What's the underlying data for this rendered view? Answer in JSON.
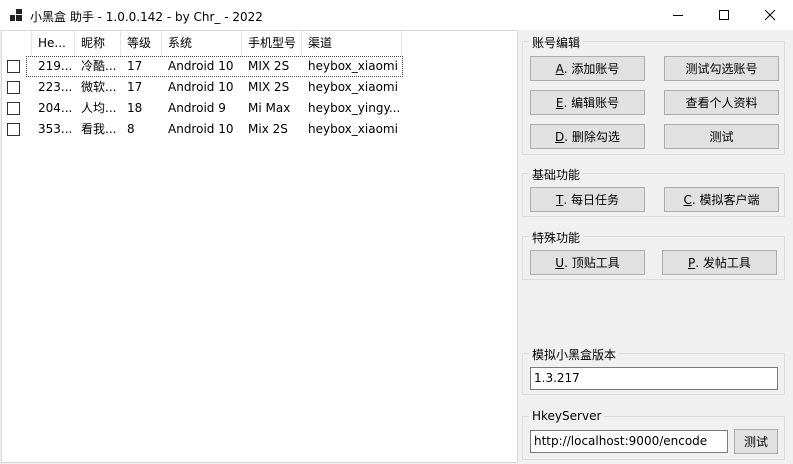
{
  "window": {
    "title": "小黑盒 助手 - 1.0.0.142 - by Chr_ - 2022",
    "icon": "app-icon",
    "controls": [
      "minimize-icon",
      "maximize-icon",
      "close-icon"
    ]
  },
  "list": {
    "columns": [
      "He...",
      "昵称",
      "等级",
      "系统",
      "手机型号",
      "渠道"
    ],
    "rows": [
      {
        "checked": false,
        "id": "219...",
        "nickname": "冷酷...",
        "level": "17",
        "os": "Android 10",
        "model": "MIX 2S",
        "channel": "heybox_xiaomi"
      },
      {
        "checked": false,
        "id": "223...",
        "nickname": "微软...",
        "level": "17",
        "os": "Android 10",
        "model": "MIX 2S",
        "channel": "heybox_xiaomi"
      },
      {
        "checked": false,
        "id": "204...",
        "nickname": "人均...",
        "level": "18",
        "os": "Android 9",
        "model": "Mi Max",
        "channel": "heybox_yingy..."
      },
      {
        "checked": false,
        "id": "353...",
        "nickname": "看我...",
        "level": "8",
        "os": "Android 10",
        "model": "Mix 2S",
        "channel": "heybox_xiaomi"
      }
    ]
  },
  "account_group": {
    "title": "账号编辑",
    "add": {
      "key": "A",
      "rest": ". 添加账号"
    },
    "test_selected": "测试勾选账号",
    "edit": {
      "key": "E",
      "rest": ". 编辑账号"
    },
    "view_profile": "查看个人资料",
    "delete": {
      "key": "D",
      "rest": ". 删除勾选"
    },
    "test": "测试"
  },
  "basic_group": {
    "title": "基础功能",
    "daily": {
      "key": "T",
      "rest": ". 每日任务"
    },
    "simulate": {
      "key": "C",
      "rest": ". 模拟客户端"
    }
  },
  "special_group": {
    "title": "特殊功能",
    "top_post": {
      "key": "U",
      "rest": ". 顶贴工具"
    },
    "post": {
      "key": "P",
      "rest": ". 发帖工具"
    }
  },
  "version_group": {
    "title": "模拟小黑盒版本",
    "value": "1.3.217"
  },
  "hkey_group": {
    "title": "HkeyServer",
    "value": "http://localhost:9000/encode",
    "test": "测试"
  }
}
